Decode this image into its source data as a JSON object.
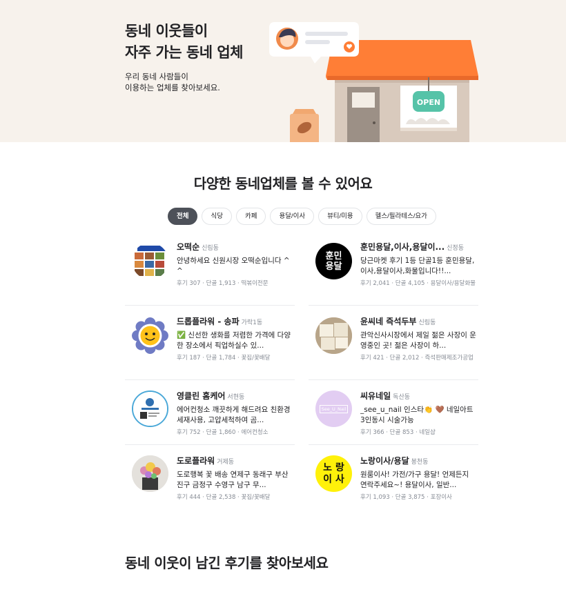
{
  "hero": {
    "title_line1": "동네 이웃들이",
    "title_line2": "자주 가는 동네 업체",
    "sub_line1": "우리 동네 사람들이",
    "sub_line2": "이용하는 업체를 찾아보세요.",
    "sign_text": "OPEN",
    "colors": {
      "background": "#f7f2ec",
      "roof": "#ff7e36",
      "sign": "#56c3a8"
    }
  },
  "section": {
    "title": "다양한 동네업체를 볼 수 있어요",
    "chips": [
      {
        "label": "전체",
        "active": true
      },
      {
        "label": "식당",
        "active": false
      },
      {
        "label": "카페",
        "active": false
      },
      {
        "label": "용달/이사",
        "active": false
      },
      {
        "label": "뷰티/미용",
        "active": false
      },
      {
        "label": "헬스/필라테스/요가",
        "active": false
      }
    ]
  },
  "businesses": [
    {
      "name": "오떡순",
      "region": "신림동",
      "desc": "안녕하세요 신원시장 오떡순입니다 ^^",
      "meta": "후기 307 · 단골 1,913 · 떡볶이전문",
      "thumb_icon": "tv-food-thumbnail"
    },
    {
      "name": "훈민용달,이사,용달이...",
      "region": "신정동",
      "desc": "당근마켓 후기 1등 단골1등 훈민용달,이사,용달이사,화물입니다!!...",
      "meta": "후기 2,041 · 단골 4,105 · 용달이사/용달화물",
      "thumb_text1": "훈민",
      "thumb_text2": "용달"
    },
    {
      "name": "드롭플라워 - 송파",
      "region": "가락1동",
      "desc": "✅ 신선한 생화를 저렴한 가격에 다양한 장소에서 픽업하실수 있...",
      "meta": "후기 187 · 단골 1,784 · 꽃집/꽃배달",
      "thumb_icon": "flower-face-thumbnail"
    },
    {
      "name": "윤씨네 즉석두부",
      "region": "신림동",
      "desc": "관악신사시장에서 제일 젊은 사장이 운영중인 곳! 젊은 사장이 하...",
      "meta": "후기 421 · 단골 2,012 · 즉석판매제조가공업",
      "thumb_icon": "tofu-thumbnail"
    },
    {
      "name": "영클린 홈케어",
      "region": "서현동",
      "desc": "에어컨청소 깨끗하게 해드려요 친환경 세재사용, 고압세척하여 곰...",
      "meta": "후기 752 · 단골 1,860 · 에어컨청소",
      "thumb_icon": "clean-logo-thumbnail"
    },
    {
      "name": "씨유네일",
      "region": "독산동",
      "desc": "_see_u_nail 인스타👏 🤎 네일아트 3인동시 시술가능",
      "meta": "후기 366 · 단골 853 · 네일샵",
      "thumb_text1": "See_U_Nail"
    },
    {
      "name": "도로플라워",
      "region": "거제동",
      "desc": "도로행복 꽃 배송 연제구 동래구 부산진구 금정구 수영구 남구 무...",
      "meta": "후기 444 · 단골 2,538 · 꽃집/꽃배달",
      "thumb_icon": "flower-pot-thumbnail"
    },
    {
      "name": "노랑이사/용달",
      "region": "봉천동",
      "desc": "원룸이사! 가전/가구 용달! 언제든지 연락주세요~! 용달이사, 일반...",
      "meta": "후기 1,093 · 단골 3,875 · 포장이사",
      "thumb_text1": "노 랑",
      "thumb_text2": "이 사"
    }
  ],
  "bottom": {
    "title": "동네 이웃이 남긴 후기를 찾아보세요"
  }
}
